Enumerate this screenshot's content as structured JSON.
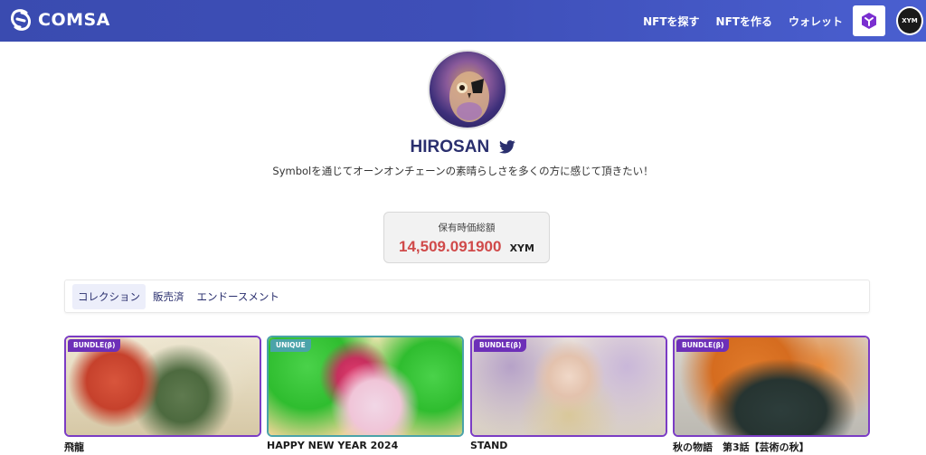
{
  "header": {
    "logo_text": "COMSA",
    "nav": [
      "NFTを探す",
      "NFTを作る",
      "ウォレット"
    ],
    "symbol_button_icon": "symbol-logo-icon",
    "avatar_text": "XYM"
  },
  "profile": {
    "name": "HIROSAN",
    "twitter_icon": "twitter-icon",
    "bio": "Symbolを通じてオーンオンチェーンの素晴らしさを多くの方に感じて頂きたい！"
  },
  "holdings": {
    "label": "保有時価総額",
    "amount": "14,509.091900",
    "unit": "XYM"
  },
  "tabs": [
    "コレクション",
    "販売済",
    "エンドースメント"
  ],
  "active_tab": "コレクション",
  "cards": [
    {
      "badge": "BUNDLE(β)",
      "title": "飛龍"
    },
    {
      "badge": "UNIQUE",
      "title": "HAPPY NEW YEAR 2024"
    },
    {
      "badge": "BUNDLE(β)",
      "title": "STAND"
    },
    {
      "badge": "BUNDLE(β)",
      "title": "秋の物語　第3話【芸術の秋】"
    }
  ],
  "colors": {
    "header_bg": "#3e4fb8",
    "accent_purple": "#6d2fb8",
    "unique_teal": "#4aa3a9",
    "amount_red": "#d04a4a"
  }
}
